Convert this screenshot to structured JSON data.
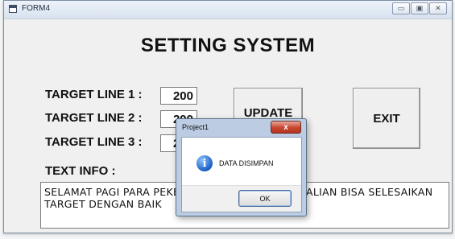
{
  "window": {
    "title": "FORM4",
    "controls": {
      "minimize": "▭",
      "maximize": "▣",
      "close": "✕"
    }
  },
  "form": {
    "heading": "SETTING SYSTEM",
    "target_lines": [
      {
        "label": "TARGET LINE 1 :",
        "value": "200"
      },
      {
        "label": "TARGET LINE 2 :",
        "value": "200"
      },
      {
        "label": "TARGET LINE 3 :",
        "value": "200"
      }
    ],
    "update_button": "UPDATE TARGET",
    "exit_button": "EXIT",
    "info_label": "TEXT INFO :",
    "info_text": "SELAMAT PAGI PARA PEKERJA, SEMOGA HARI INI KALIAN BISA SELESAIKAN TARGET DENGAN BAIK"
  },
  "dialog": {
    "title": "Project1",
    "close_label": "x",
    "icon": "information-icon",
    "message": "DATA DISIMPAN",
    "ok_label": "OK"
  }
}
